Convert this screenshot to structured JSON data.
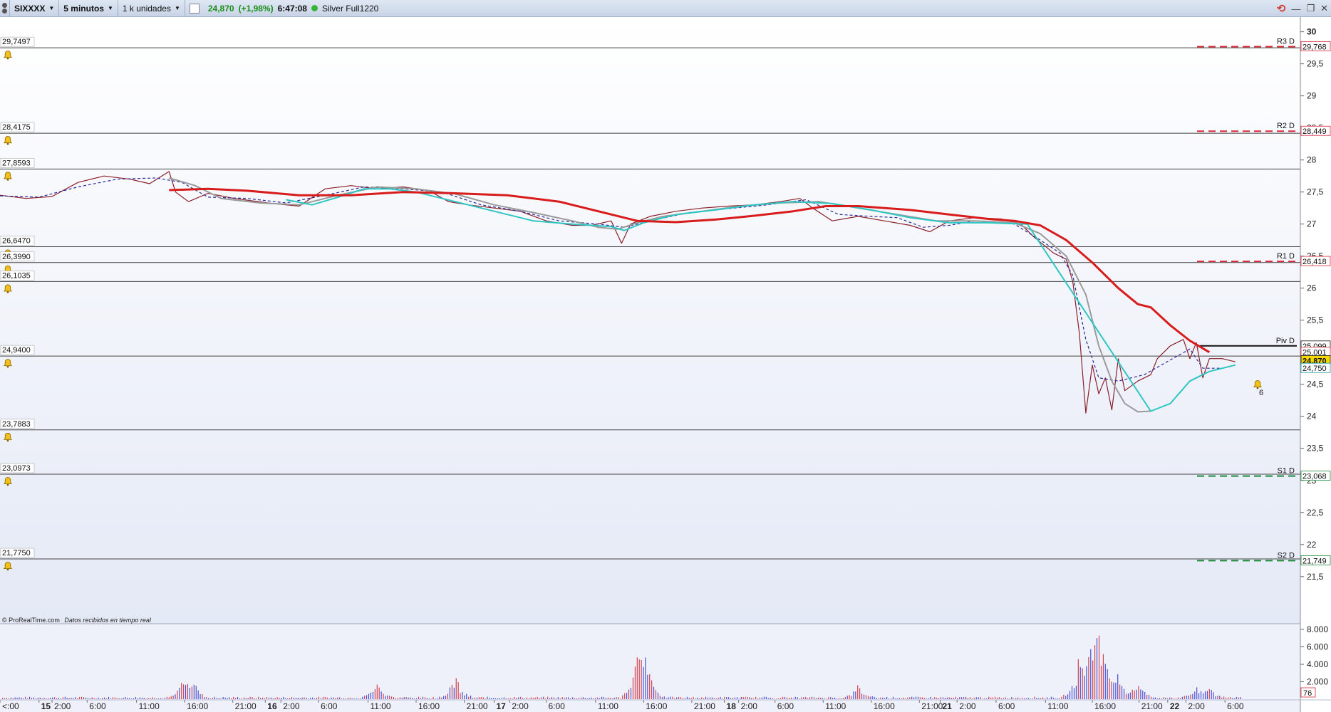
{
  "toolbar": {
    "instrument": "SIXXXX",
    "interval": "5 minutos",
    "units": "1 k unidades",
    "price": "24,870",
    "change": "(+1,98%)",
    "time": "6:47:08",
    "account": "Silver Full1220"
  },
  "chart_data": {
    "type": "line",
    "y_ticks": [
      "30",
      "29,5",
      "29",
      "28,5",
      "28",
      "27,5",
      "27",
      "26,5",
      "26",
      "25,5",
      "25",
      "24,5",
      "24",
      "23,5",
      "23",
      "22,5",
      "22",
      "21,5"
    ],
    "ylim": [
      21.12,
      30.14
    ],
    "volume_ticks": [
      "8.000",
      "6.000",
      "4.000",
      "2.000",
      "0"
    ],
    "volume_cut": "76",
    "x_labels": [
      {
        "t": 0,
        "label": "<:00"
      },
      {
        "t": 0.03,
        "label": "15",
        "bold": true
      },
      {
        "t": 0.04,
        "label": "2:00"
      },
      {
        "t": 0.067,
        "label": "6:00"
      },
      {
        "t": 0.105,
        "label": "11:00"
      },
      {
        "t": 0.142,
        "label": "16:00"
      },
      {
        "t": 0.179,
        "label": "21:00"
      },
      {
        "t": 0.204,
        "label": "16",
        "bold": true
      },
      {
        "t": 0.216,
        "label": "2:00"
      },
      {
        "t": 0.245,
        "label": "6:00"
      },
      {
        "t": 0.283,
        "label": "11:00"
      },
      {
        "t": 0.32,
        "label": "16:00"
      },
      {
        "t": 0.357,
        "label": "21:00"
      },
      {
        "t": 0.38,
        "label": "17",
        "bold": true
      },
      {
        "t": 0.392,
        "label": "2:00"
      },
      {
        "t": 0.42,
        "label": "6:00"
      },
      {
        "t": 0.458,
        "label": "11:00"
      },
      {
        "t": 0.495,
        "label": "16:00"
      },
      {
        "t": 0.532,
        "label": "21:00"
      },
      {
        "t": 0.557,
        "label": "18",
        "bold": true
      },
      {
        "t": 0.568,
        "label": "2:00"
      },
      {
        "t": 0.596,
        "label": "6:00"
      },
      {
        "t": 0.633,
        "label": "11:00"
      },
      {
        "t": 0.67,
        "label": "16:00"
      },
      {
        "t": 0.707,
        "label": "21:00"
      },
      {
        "t": 0.723,
        "label": "21",
        "bold": true
      },
      {
        "t": 0.736,
        "label": "2:00"
      },
      {
        "t": 0.766,
        "label": "6:00"
      },
      {
        "t": 0.804,
        "label": "11:00"
      },
      {
        "t": 0.84,
        "label": "16:00"
      },
      {
        "t": 0.876,
        "label": "21:00"
      },
      {
        "t": 0.898,
        "label": "22",
        "bold": true
      },
      {
        "t": 0.912,
        "label": "2:00"
      },
      {
        "t": 0.942,
        "label": "6:00"
      }
    ],
    "h_lines": [
      {
        "value": 29.7497,
        "label": "29,7497"
      },
      {
        "value": 28.4175,
        "label": "28,4175"
      },
      {
        "value": 27.8593,
        "label": "27,8593"
      },
      {
        "value": 26.647,
        "label": "26,6470"
      },
      {
        "value": 26.399,
        "label": "26,3990"
      },
      {
        "value": 26.1035,
        "label": "26,1035"
      },
      {
        "value": 24.94,
        "label": "24,9400"
      },
      {
        "value": 23.7883,
        "label": "23,7883"
      },
      {
        "value": 23.0973,
        "label": "23,0973"
      },
      {
        "value": 21.775,
        "label": "21,7750"
      }
    ],
    "pivots": [
      {
        "name": "R3 D",
        "value": 29.768,
        "label": "29,768",
        "color": "#d8283a"
      },
      {
        "name": "R2 D",
        "value": 28.449,
        "label": "28,449",
        "color": "#d8283a"
      },
      {
        "name": "R1 D",
        "value": 26.418,
        "label": "26,418",
        "color": "#d8283a"
      },
      {
        "name": "Piv D",
        "value": 25.099,
        "label": "25,099",
        "color": "#111111"
      },
      {
        "name": "S1 D",
        "value": 23.068,
        "label": "23,068",
        "color": "#1a8a3a"
      },
      {
        "name": "S2 D",
        "value": 21.749,
        "label": "21,749",
        "color": "#1a8a3a"
      }
    ],
    "right_tags": [
      {
        "value": 25.001,
        "label": "25,001",
        "color": "#d8283a"
      },
      {
        "value": 24.87,
        "label": "24,870",
        "color": "#111111",
        "highlight": true
      },
      {
        "value": 24.75,
        "label": "24,750",
        "color": "#1aa0b0"
      }
    ],
    "alert_count": "6",
    "series": [
      {
        "name": "price",
        "color": "#8a1f2a",
        "points": [
          [
            0,
            27.45
          ],
          [
            0.02,
            27.4
          ],
          [
            0.04,
            27.43
          ],
          [
            0.06,
            27.65
          ],
          [
            0.08,
            27.75
          ],
          [
            0.1,
            27.7
          ],
          [
            0.115,
            27.63
          ],
          [
            0.13,
            27.82
          ],
          [
            0.135,
            27.5
          ],
          [
            0.145,
            27.35
          ],
          [
            0.16,
            27.48
          ],
          [
            0.18,
            27.4
          ],
          [
            0.21,
            27.32
          ],
          [
            0.23,
            27.28
          ],
          [
            0.25,
            27.55
          ],
          [
            0.27,
            27.6
          ],
          [
            0.29,
            27.55
          ],
          [
            0.31,
            27.58
          ],
          [
            0.33,
            27.52
          ],
          [
            0.345,
            27.35
          ],
          [
            0.36,
            27.3
          ],
          [
            0.38,
            27.25
          ],
          [
            0.4,
            27.2
          ],
          [
            0.42,
            27.05
          ],
          [
            0.44,
            26.98
          ],
          [
            0.455,
            26.98
          ],
          [
            0.47,
            27.05
          ],
          [
            0.478,
            26.7
          ],
          [
            0.485,
            27.0
          ],
          [
            0.5,
            27.12
          ],
          [
            0.52,
            27.2
          ],
          [
            0.54,
            27.25
          ],
          [
            0.56,
            27.28
          ],
          [
            0.58,
            27.3
          ],
          [
            0.6,
            27.35
          ],
          [
            0.615,
            27.4
          ],
          [
            0.625,
            27.25
          ],
          [
            0.64,
            27.05
          ],
          [
            0.66,
            27.12
          ],
          [
            0.68,
            27.05
          ],
          [
            0.7,
            26.98
          ],
          [
            0.715,
            26.88
          ],
          [
            0.73,
            27.05
          ],
          [
            0.75,
            27.1
          ],
          [
            0.77,
            27.08
          ],
          [
            0.785,
            27.0
          ],
          [
            0.795,
            26.8
          ],
          [
            0.81,
            26.55
          ],
          [
            0.82,
            26.45
          ],
          [
            0.825,
            26.1
          ],
          [
            0.83,
            25.3
          ],
          [
            0.835,
            24.05
          ],
          [
            0.84,
            24.8
          ],
          [
            0.845,
            24.35
          ],
          [
            0.85,
            24.6
          ],
          [
            0.855,
            24.1
          ],
          [
            0.86,
            24.9
          ],
          [
            0.865,
            24.4
          ],
          [
            0.875,
            24.55
          ],
          [
            0.885,
            24.65
          ],
          [
            0.89,
            24.9
          ],
          [
            0.895,
            25.0
          ],
          [
            0.9,
            25.1
          ],
          [
            0.91,
            25.2
          ],
          [
            0.915,
            24.9
          ],
          [
            0.92,
            25.15
          ],
          [
            0.925,
            24.6
          ],
          [
            0.93,
            24.9
          ],
          [
            0.94,
            24.9
          ],
          [
            0.95,
            24.85
          ]
        ]
      },
      {
        "name": "sma-dash",
        "color": "#2a2a9a",
        "dash": "4,3",
        "points": [
          [
            0,
            27.44
          ],
          [
            0.03,
            27.42
          ],
          [
            0.06,
            27.58
          ],
          [
            0.09,
            27.7
          ],
          [
            0.12,
            27.72
          ],
          [
            0.14,
            27.65
          ],
          [
            0.16,
            27.42
          ],
          [
            0.19,
            27.4
          ],
          [
            0.22,
            27.33
          ],
          [
            0.25,
            27.45
          ],
          [
            0.28,
            27.58
          ],
          [
            0.31,
            27.55
          ],
          [
            0.34,
            27.5
          ],
          [
            0.37,
            27.3
          ],
          [
            0.4,
            27.2
          ],
          [
            0.43,
            27.05
          ],
          [
            0.46,
            27.0
          ],
          [
            0.48,
            26.95
          ],
          [
            0.5,
            27.05
          ],
          [
            0.53,
            27.18
          ],
          [
            0.56,
            27.24
          ],
          [
            0.59,
            27.3
          ],
          [
            0.62,
            27.38
          ],
          [
            0.645,
            27.15
          ],
          [
            0.67,
            27.12
          ],
          [
            0.69,
            27.1
          ],
          [
            0.71,
            26.95
          ],
          [
            0.73,
            26.98
          ],
          [
            0.75,
            27.05
          ],
          [
            0.78,
            27.0
          ],
          [
            0.8,
            26.75
          ],
          [
            0.815,
            26.55
          ],
          [
            0.825,
            26.2
          ],
          [
            0.835,
            25.2
          ],
          [
            0.845,
            24.6
          ],
          [
            0.86,
            24.55
          ],
          [
            0.88,
            24.65
          ],
          [
            0.9,
            24.88
          ],
          [
            0.915,
            25.05
          ],
          [
            0.925,
            24.75
          ],
          [
            0.94,
            24.75
          ],
          [
            0.95,
            24.8
          ]
        ]
      },
      {
        "name": "sma-grey",
        "color": "#9a9a9a",
        "width": 2,
        "points": [
          [
            0.13,
            27.72
          ],
          [
            0.15,
            27.6
          ],
          [
            0.17,
            27.4
          ],
          [
            0.2,
            27.33
          ],
          [
            0.23,
            27.3
          ],
          [
            0.26,
            27.45
          ],
          [
            0.29,
            27.58
          ],
          [
            0.32,
            27.55
          ],
          [
            0.35,
            27.47
          ],
          [
            0.38,
            27.3
          ],
          [
            0.41,
            27.18
          ],
          [
            0.44,
            27.05
          ],
          [
            0.46,
            26.95
          ],
          [
            0.475,
            26.92
          ],
          [
            0.49,
            27.02
          ],
          [
            0.51,
            27.12
          ],
          [
            0.54,
            27.2
          ],
          [
            0.57,
            27.28
          ],
          [
            0.6,
            27.33
          ],
          [
            0.63,
            27.35
          ],
          [
            0.66,
            27.25
          ],
          [
            0.69,
            27.15
          ],
          [
            0.72,
            27.05
          ],
          [
            0.75,
            27.05
          ],
          [
            0.78,
            27.02
          ],
          [
            0.8,
            26.85
          ],
          [
            0.82,
            26.5
          ],
          [
            0.835,
            25.9
          ],
          [
            0.845,
            25.1
          ],
          [
            0.855,
            24.55
          ],
          [
            0.865,
            24.2
          ],
          [
            0.875,
            24.07
          ],
          [
            0.885,
            24.08
          ]
        ]
      },
      {
        "name": "sma-cyan",
        "color": "#2ec6c2",
        "width": 2,
        "points": [
          [
            0.22,
            27.38
          ],
          [
            0.24,
            27.3
          ],
          [
            0.26,
            27.42
          ],
          [
            0.28,
            27.55
          ],
          [
            0.3,
            27.55
          ],
          [
            0.32,
            27.5
          ],
          [
            0.34,
            27.4
          ],
          [
            0.36,
            27.3
          ],
          [
            0.38,
            27.2
          ],
          [
            0.41,
            27.05
          ],
          [
            0.44,
            27.0
          ],
          [
            0.47,
            26.96
          ],
          [
            0.48,
            26.9
          ],
          [
            0.495,
            27.02
          ],
          [
            0.52,
            27.15
          ],
          [
            0.55,
            27.22
          ],
          [
            0.58,
            27.3
          ],
          [
            0.61,
            27.35
          ],
          [
            0.64,
            27.32
          ],
          [
            0.67,
            27.22
          ],
          [
            0.7,
            27.1
          ],
          [
            0.73,
            27.02
          ],
          [
            0.76,
            27.02
          ],
          [
            0.79,
            27.0
          ],
          [
            0.885,
            24.08
          ],
          [
            0.9,
            24.2
          ],
          [
            0.915,
            24.55
          ],
          [
            0.93,
            24.7
          ],
          [
            0.95,
            24.8
          ]
        ]
      },
      {
        "name": "sma-red",
        "color": "#d81b1b",
        "width": 3,
        "points": [
          [
            0.13,
            27.53
          ],
          [
            0.16,
            27.55
          ],
          [
            0.19,
            27.52
          ],
          [
            0.23,
            27.45
          ],
          [
            0.27,
            27.45
          ],
          [
            0.31,
            27.5
          ],
          [
            0.35,
            27.48
          ],
          [
            0.39,
            27.45
          ],
          [
            0.43,
            27.35
          ],
          [
            0.46,
            27.2
          ],
          [
            0.49,
            27.05
          ],
          [
            0.52,
            27.03
          ],
          [
            0.55,
            27.07
          ],
          [
            0.58,
            27.13
          ],
          [
            0.61,
            27.2
          ],
          [
            0.635,
            27.28
          ],
          [
            0.66,
            27.28
          ],
          [
            0.7,
            27.22
          ],
          [
            0.73,
            27.15
          ],
          [
            0.76,
            27.08
          ],
          [
            0.78,
            27.05
          ],
          [
            0.8,
            26.98
          ],
          [
            0.82,
            26.75
          ],
          [
            0.84,
            26.4
          ],
          [
            0.86,
            26.0
          ],
          [
            0.875,
            25.75
          ],
          [
            0.885,
            25.7
          ],
          [
            0.9,
            25.42
          ],
          [
            0.915,
            25.18
          ],
          [
            0.93,
            25.0
          ]
        ]
      }
    ]
  },
  "legend": {
    "copyright": "© ProRealTime.com",
    "realtime": "Datos recibidos en tiempo real"
  }
}
